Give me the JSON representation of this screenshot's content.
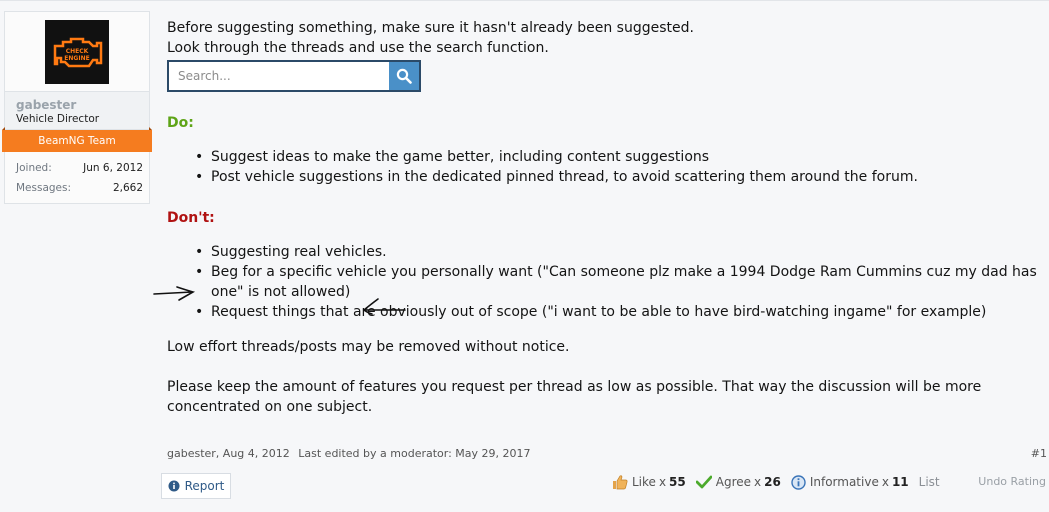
{
  "user": {
    "name": "gabester",
    "title": "Vehicle Director",
    "banner": "BeamNG Team",
    "avatar_text": "CHECK ENGINE",
    "stats": [
      {
        "key": "Joined:",
        "value": "Jun 6, 2012"
      },
      {
        "key": "Messages:",
        "value": "2,662"
      }
    ]
  },
  "message": {
    "intro_line1": "Before suggesting something, make sure it hasn't already been suggested.",
    "intro_line2": "Look through the threads and use the search function.",
    "search_placeholder": "Search...",
    "do_heading": "Do:",
    "do_items": [
      "Suggest ideas to make the game better, including content suggestions",
      "Post vehicle suggestions in the dedicated pinned thread, to avoid scattering them around the forum."
    ],
    "dont_heading": "Don't:",
    "dont_items": [
      "Suggesting real vehicles.",
      "Beg for a specific vehicle you personally want (\"Can someone plz make a 1994 Dodge Ram Cummins cuz my dad has one\" is not allowed)",
      "Request things that are obviously out of scope (\"i want to be able to have bird-watching ingame\" for example)"
    ],
    "para1": "Low effort threads/posts may be removed without notice.",
    "para2": "Please keep the amount of features you request per thread as low as possible. That way the discussion will be more concentrated on one subject."
  },
  "footer": {
    "author_date": "gabester, Aug 4, 2012",
    "edited": "Last edited by a moderator: May 29, 2017",
    "post_number": "#1",
    "report_label": "Report",
    "ratings": [
      {
        "label": "Like",
        "count": "55",
        "icon": "thumbs-up-icon"
      },
      {
        "label": "Agree",
        "count": "26",
        "icon": "checkmark-icon"
      },
      {
        "label": "Informative",
        "count": "11",
        "icon": "info-icon"
      }
    ],
    "times": "x",
    "list_label": "List",
    "undo_label": "Undo Rating"
  },
  "colors": {
    "do": "#5ea417",
    "dont": "#b01212",
    "banner": "#f57c1f",
    "link": "#2f5a87",
    "search_button": "#4a90c8"
  }
}
